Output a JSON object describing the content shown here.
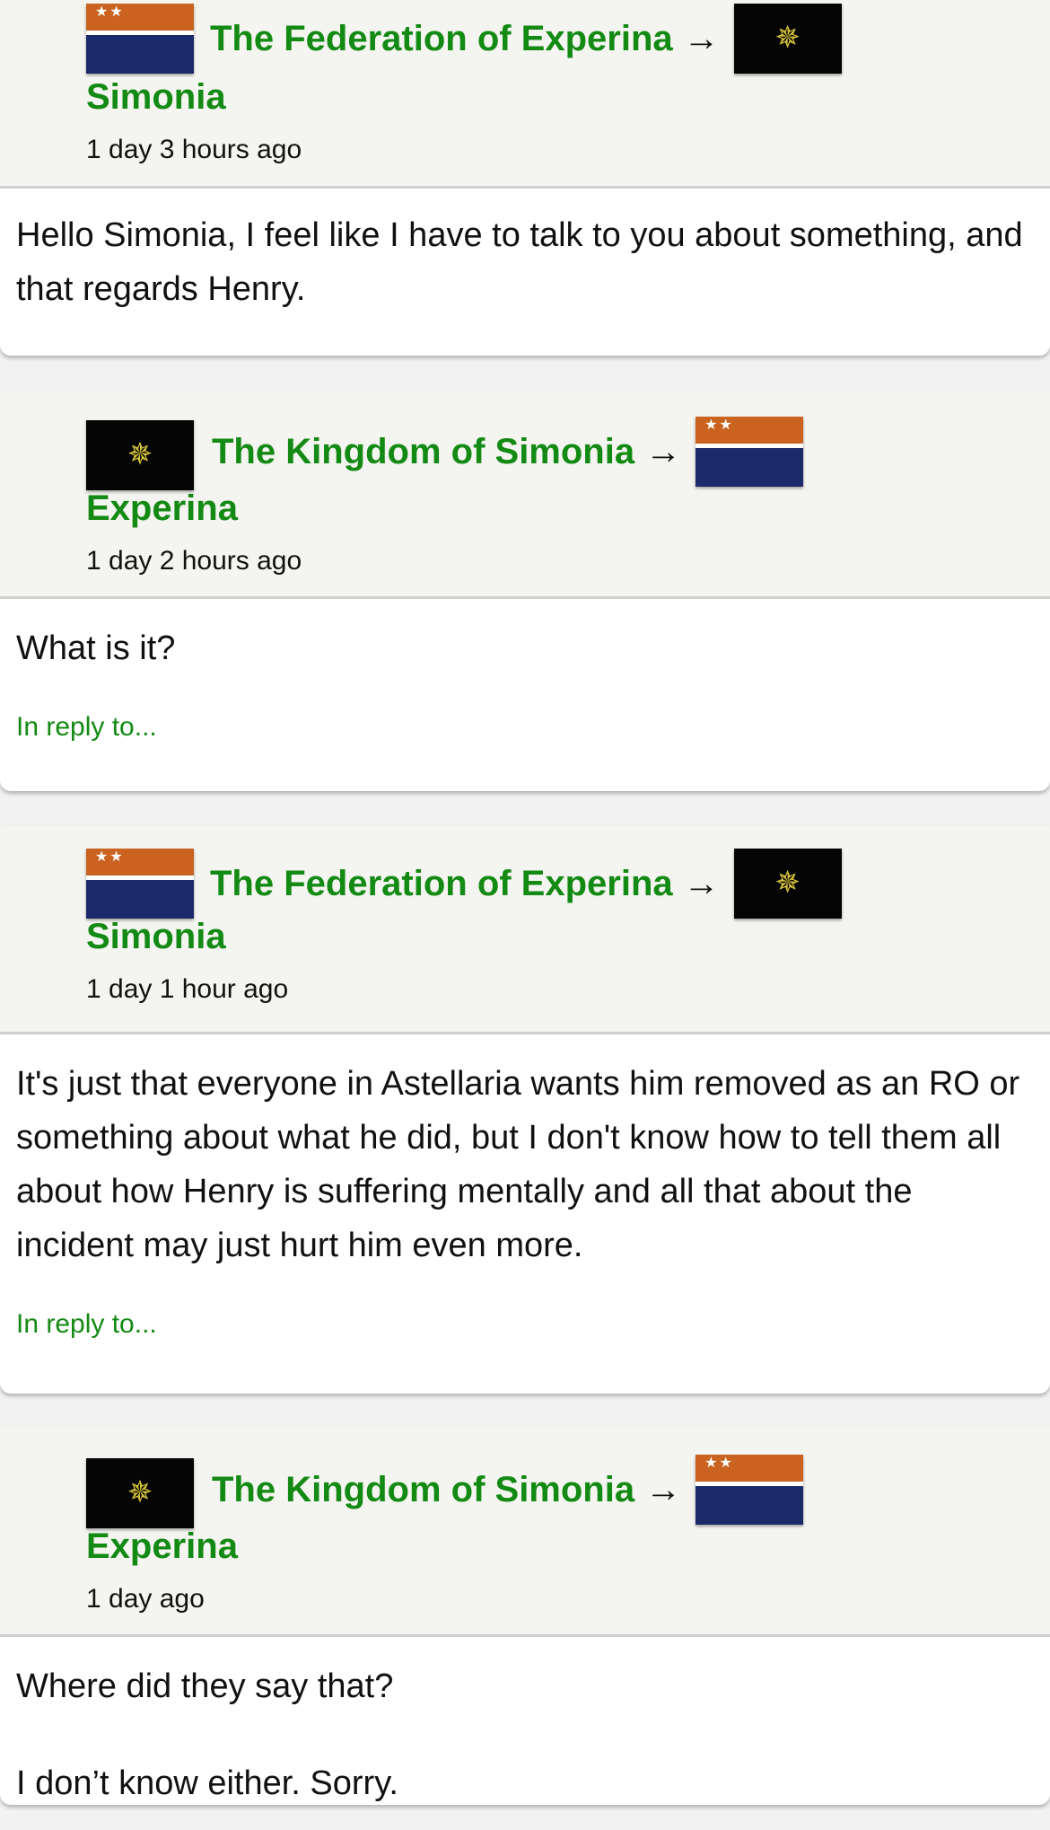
{
  "flags": {
    "experina": {
      "colors": {
        "top": "#c9631f",
        "bottom": "#1a2a6b",
        "stripe": "#ffffff"
      },
      "icon": "two-stars",
      "stars": "★★"
    },
    "simonia": {
      "colors": {
        "field": "#050505",
        "emblem": "#d8c43a"
      },
      "icon": "star-emblem",
      "emblem": "✵"
    }
  },
  "colors": {
    "link": "#138a13"
  },
  "messages": [
    {
      "from_name": "The Federation of Experina",
      "from_flag": "experina",
      "arrow": "→",
      "to_name": "Simonia",
      "to_flag": "simonia",
      "timestamp": "1 day 3 hours ago",
      "body": [
        "Hello Simonia, I feel like I have to talk to you about something, and that regards Henry."
      ],
      "reply": ""
    },
    {
      "from_name": "The Kingdom of Simonia",
      "from_flag": "simonia",
      "arrow": "→",
      "to_name": "Experina",
      "to_flag": "experina",
      "timestamp": "1 day 2 hours ago",
      "body": [
        "What is it?"
      ],
      "reply": "In reply to..."
    },
    {
      "from_name": "The Federation of Experina",
      "from_flag": "experina",
      "arrow": "→",
      "to_name": "Simonia",
      "to_flag": "simonia",
      "timestamp": "1 day 1 hour ago",
      "body": [
        "It's just that everyone in Astellaria wants him removed as an RO or something about what he did, but I don't know how to tell them all about how Henry is suffering mentally and all that about the incident may just hurt him even more."
      ],
      "reply": "In reply to..."
    },
    {
      "from_name": "The Kingdom of Simonia",
      "from_flag": "simonia",
      "arrow": "→",
      "to_name": "Experina",
      "to_flag": "experina",
      "timestamp": "1 day ago",
      "body": [
        "Where did they say that?",
        "I don’t know either. Sorry."
      ],
      "reply": ""
    }
  ]
}
